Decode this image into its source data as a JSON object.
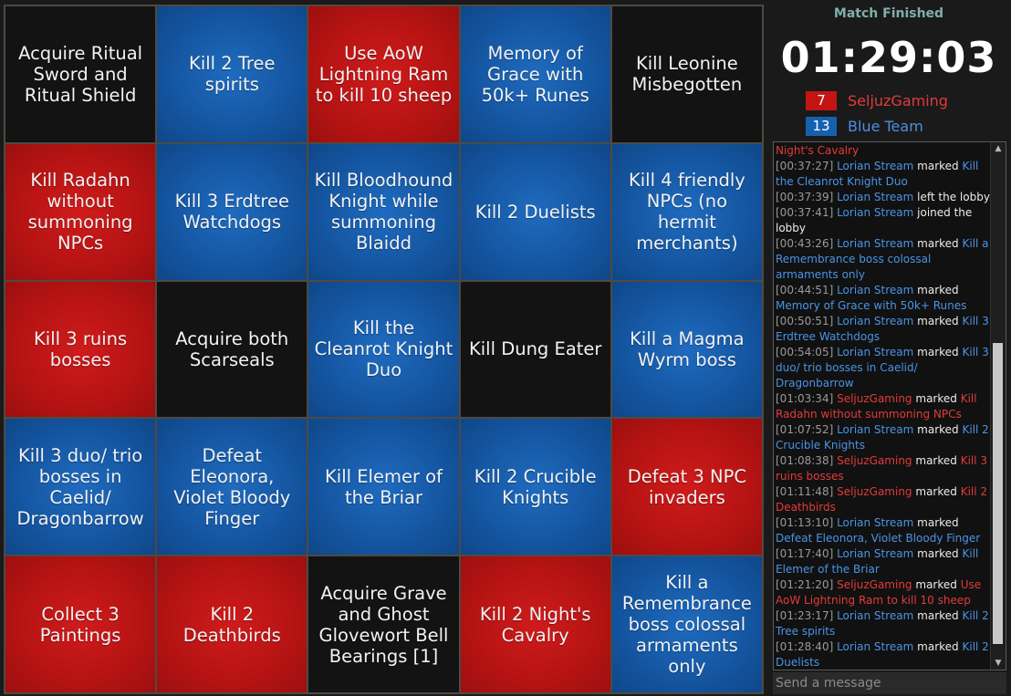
{
  "colors": {
    "blue": "#1455a0",
    "red": "#b51313",
    "black": "#131313",
    "status": "#7fb0a8"
  },
  "board": [
    {
      "text": "Acquire Ritual Sword and Ritual Shield",
      "team": "black"
    },
    {
      "text": "Kill 2 Tree spirits",
      "team": "blue"
    },
    {
      "text": "Use AoW Lightning Ram to kill 10 sheep",
      "team": "red"
    },
    {
      "text": "Memory of Grace with 50k+ Runes",
      "team": "blue"
    },
    {
      "text": "Kill Leonine Misbegotten",
      "team": "black"
    },
    {
      "text": "Kill Radahn without summoning NPCs",
      "team": "red"
    },
    {
      "text": "Kill 3 Erdtree Watchdogs",
      "team": "blue"
    },
    {
      "text": "Kill Bloodhound Knight while summoning Blaidd",
      "team": "blue"
    },
    {
      "text": "Kill 2 Duelists",
      "team": "blue"
    },
    {
      "text": "Kill 4 friendly NPCs (no hermit merchants)",
      "team": "blue"
    },
    {
      "text": "Kill 3 ruins bosses",
      "team": "red"
    },
    {
      "text": "Acquire both Scarseals",
      "team": "black"
    },
    {
      "text": "Kill the Cleanrot Knight Duo",
      "team": "blue"
    },
    {
      "text": "Kill Dung Eater",
      "team": "black"
    },
    {
      "text": "Kill a Magma Wyrm boss",
      "team": "blue"
    },
    {
      "text": "Kill 3 duo/ trio bosses in Caelid/ Dragonbarrow",
      "team": "blue"
    },
    {
      "text": "Defeat Eleonora, Violet Bloody Finger",
      "team": "blue"
    },
    {
      "text": "Kill Elemer of the Briar",
      "team": "blue"
    },
    {
      "text": "Kill 2 Crucible Knights",
      "team": "blue"
    },
    {
      "text": "Defeat 3 NPC invaders",
      "team": "red"
    },
    {
      "text": "Collect 3 Paintings",
      "team": "red"
    },
    {
      "text": "Kill 2 Deathbirds",
      "team": "red"
    },
    {
      "text": "Acquire Grave and Ghost Glovewort Bell Bearings [1]",
      "team": "black"
    },
    {
      "text": "Kill 2 Night's Cavalry",
      "team": "red"
    },
    {
      "text": "Kill a Remembrance boss colossal armaments only",
      "team": "blue"
    }
  ],
  "sidebar": {
    "status": "Match Finished",
    "timer": "01:29:03",
    "teams": [
      {
        "score": "7",
        "name": "SeljuzGaming"
      },
      {
        "score": "13",
        "name": "Blue Team"
      }
    ],
    "message_placeholder": "Send a message"
  },
  "chat": [
    {
      "parts": [
        {
          "c": "red",
          "t": "Night's Cavalry"
        }
      ]
    },
    {
      "parts": [
        {
          "c": "ts",
          "t": "[00:37:27] "
        },
        {
          "c": "blue",
          "t": "Lorian Stream"
        },
        {
          "c": "plain",
          "t": " marked "
        },
        {
          "c": "blue",
          "t": "Kill the Cleanrot Knight Duo"
        }
      ]
    },
    {
      "parts": [
        {
          "c": "ts",
          "t": "[00:37:39] "
        },
        {
          "c": "blue",
          "t": "Lorian Stream"
        },
        {
          "c": "plain",
          "t": " left the lobby"
        }
      ]
    },
    {
      "parts": [
        {
          "c": "ts",
          "t": "[00:37:41] "
        },
        {
          "c": "blue",
          "t": "Lorian Stream"
        },
        {
          "c": "plain",
          "t": " joined the lobby"
        }
      ]
    },
    {
      "parts": [
        {
          "c": "ts",
          "t": "[00:43:26] "
        },
        {
          "c": "blue",
          "t": "Lorian Stream"
        },
        {
          "c": "plain",
          "t": " marked "
        },
        {
          "c": "blue",
          "t": "Kill a Remembrance boss colossal armaments only"
        }
      ]
    },
    {
      "parts": [
        {
          "c": "ts",
          "t": "[00:44:51] "
        },
        {
          "c": "blue",
          "t": "Lorian Stream"
        },
        {
          "c": "plain",
          "t": " marked "
        },
        {
          "c": "blue",
          "t": "Memory of Grace with 50k+ Runes"
        }
      ]
    },
    {
      "parts": [
        {
          "c": "ts",
          "t": "[00:50:51] "
        },
        {
          "c": "blue",
          "t": "Lorian Stream"
        },
        {
          "c": "plain",
          "t": " marked "
        },
        {
          "c": "blue",
          "t": "Kill 3 Erdtree Watchdogs"
        }
      ]
    },
    {
      "parts": [
        {
          "c": "ts",
          "t": "[00:54:05] "
        },
        {
          "c": "blue",
          "t": "Lorian Stream"
        },
        {
          "c": "plain",
          "t": " marked "
        },
        {
          "c": "blue",
          "t": "Kill 3 duo/ trio bosses in Caelid/ Dragonbarrow"
        }
      ]
    },
    {
      "parts": [
        {
          "c": "ts",
          "t": "[01:03:34] "
        },
        {
          "c": "red",
          "t": "SeljuzGaming"
        },
        {
          "c": "plain",
          "t": " marked "
        },
        {
          "c": "red",
          "t": "Kill Radahn without summoning NPCs"
        }
      ]
    },
    {
      "parts": [
        {
          "c": "ts",
          "t": "[01:07:52] "
        },
        {
          "c": "blue",
          "t": "Lorian Stream"
        },
        {
          "c": "plain",
          "t": " marked "
        },
        {
          "c": "blue",
          "t": "Kill 2 Crucible Knights"
        }
      ]
    },
    {
      "parts": [
        {
          "c": "ts",
          "t": "[01:08:38] "
        },
        {
          "c": "red",
          "t": "SeljuzGaming"
        },
        {
          "c": "plain",
          "t": " marked "
        },
        {
          "c": "red",
          "t": "Kill 3 ruins bosses"
        }
      ]
    },
    {
      "parts": [
        {
          "c": "ts",
          "t": "[01:11:48] "
        },
        {
          "c": "red",
          "t": "SeljuzGaming"
        },
        {
          "c": "plain",
          "t": " marked "
        },
        {
          "c": "red",
          "t": "Kill 2 Deathbirds"
        }
      ]
    },
    {
      "parts": [
        {
          "c": "ts",
          "t": "[01:13:10] "
        },
        {
          "c": "blue",
          "t": "Lorian Stream"
        },
        {
          "c": "plain",
          "t": " marked "
        },
        {
          "c": "blue",
          "t": "Defeat Eleonora, Violet Bloody Finger"
        }
      ]
    },
    {
      "parts": [
        {
          "c": "ts",
          "t": "[01:17:40] "
        },
        {
          "c": "blue",
          "t": "Lorian Stream"
        },
        {
          "c": "plain",
          "t": " marked "
        },
        {
          "c": "blue",
          "t": "Kill Elemer of the Briar"
        }
      ]
    },
    {
      "parts": [
        {
          "c": "ts",
          "t": "[01:21:20] "
        },
        {
          "c": "red",
          "t": "SeljuzGaming"
        },
        {
          "c": "plain",
          "t": " marked "
        },
        {
          "c": "red",
          "t": "Use AoW Lightning Ram to kill 10 sheep"
        }
      ]
    },
    {
      "parts": [
        {
          "c": "ts",
          "t": "[01:23:17] "
        },
        {
          "c": "blue",
          "t": "Lorian Stream"
        },
        {
          "c": "plain",
          "t": " marked "
        },
        {
          "c": "blue",
          "t": "Kill 2 Tree spirits"
        }
      ]
    },
    {
      "parts": [
        {
          "c": "ts",
          "t": "[01:28:40] "
        },
        {
          "c": "blue",
          "t": "Lorian Stream"
        },
        {
          "c": "plain",
          "t": " marked "
        },
        {
          "c": "blue",
          "t": "Kill 2 Duelists"
        }
      ]
    }
  ]
}
